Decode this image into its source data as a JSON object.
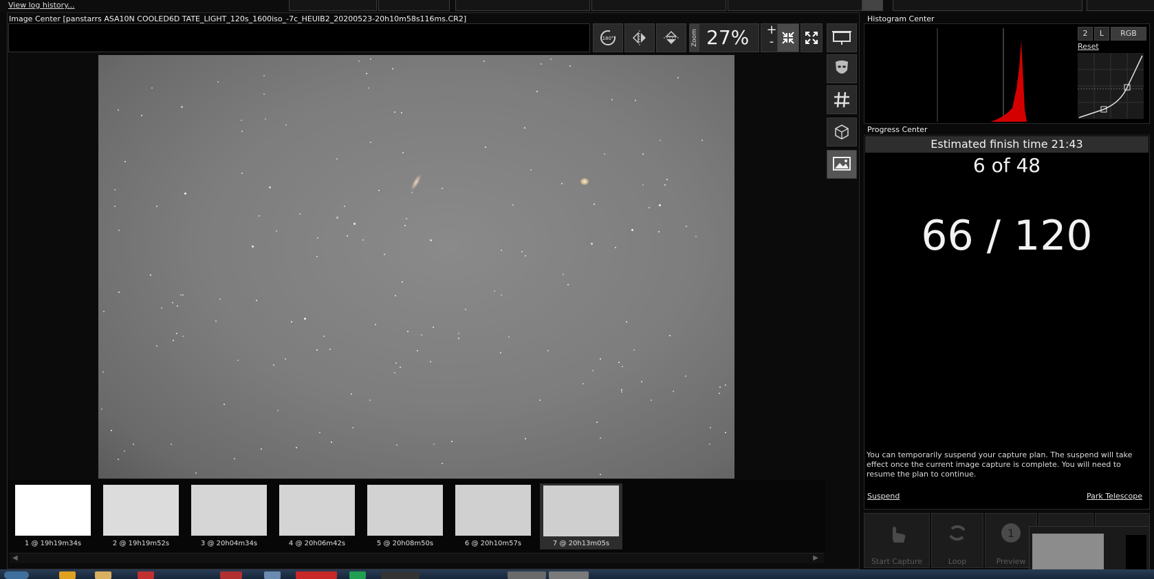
{
  "top": {
    "log_link": "View log history..."
  },
  "image_center": {
    "title": "Image  Center  [panstarrs  ASA10N  COOLED6D  TATE_LIGHT_120s_1600iso_-7c_HEUIB2_20200523-20h10m58s116ms.CR2]",
    "zoom_label": "Zoom",
    "zoom_value": "27%",
    "zoom_plus": "+",
    "zoom_minus": "-",
    "rotate_label": "180°"
  },
  "thumbnails": [
    {
      "caption": "1 @ 19h19m34s"
    },
    {
      "caption": "2 @ 19h19m52s"
    },
    {
      "caption": "3 @ 20h04m34s"
    },
    {
      "caption": "4 @ 20h06m42s"
    },
    {
      "caption": "5 @ 20h08m50s"
    },
    {
      "caption": "6 @ 20h10m57s"
    },
    {
      "caption": "7 @ 20h13m05s"
    }
  ],
  "histogram": {
    "title": "Histogram Center",
    "btn_2": "2",
    "btn_l": "L",
    "btn_rgb": "RGB",
    "reset": "Reset"
  },
  "progress": {
    "title": "Progress Center",
    "estimated": "Estimated finish time 21:43",
    "frame_count": "6 of 48",
    "exposure": "66 / 120",
    "suspend_info": "You can temporarily suspend your capture plan.  The suspend will take effect once the current image capture is complete.  You will need to resume the plan to continue.",
    "suspend": "Suspend",
    "park": "Park Telescope"
  },
  "bottom_buttons": {
    "start_capture": "Start Capture",
    "loop": "Loop",
    "preview": "Preview"
  },
  "colors": {
    "histogram_red": "#d40000",
    "panel_bg": "#000000",
    "button_bg": "#2a2a2a"
  }
}
